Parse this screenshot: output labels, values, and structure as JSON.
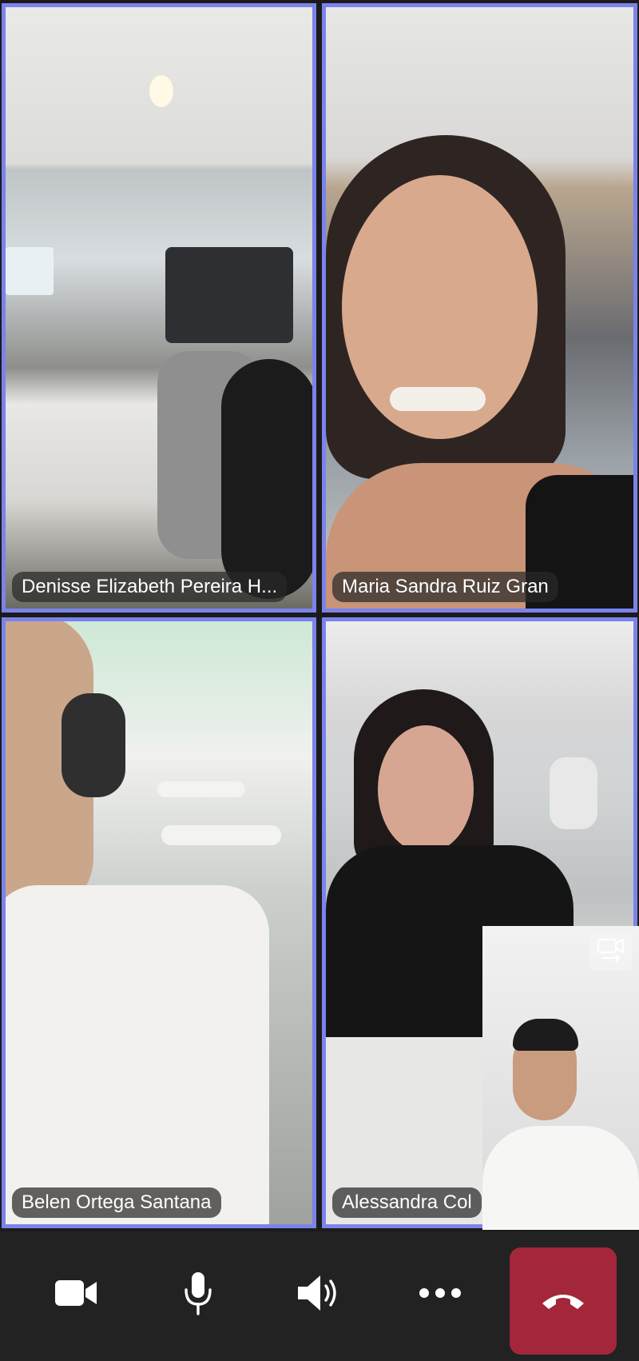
{
  "participants": [
    {
      "name": "Denisse Elizabeth Pereira H..."
    },
    {
      "name": "Maria Sandra Ruiz Gran"
    },
    {
      "name": "Belen Ortega Santana"
    },
    {
      "name": "Alessandra Col"
    }
  ],
  "colors": {
    "active_border": "#7b83eb",
    "hangup": "#a4263a",
    "control_bar": "#222222"
  },
  "controls": [
    {
      "icon": "camera-icon"
    },
    {
      "icon": "microphone-icon"
    },
    {
      "icon": "speaker-icon"
    },
    {
      "icon": "more-icon"
    },
    {
      "icon": "hangup-icon"
    }
  ],
  "self_preview": {
    "icon": "camera-switch-icon"
  }
}
